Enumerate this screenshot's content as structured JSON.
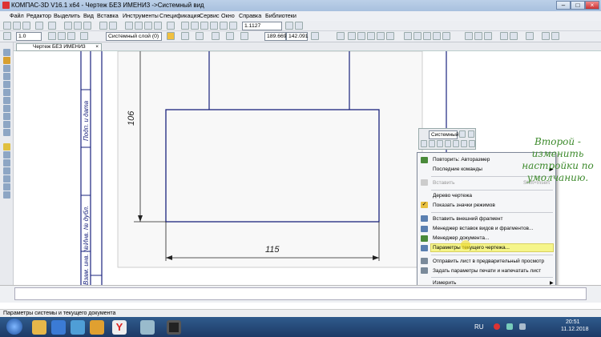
{
  "window": {
    "title": "КОМПАС-3D V16.1 x64 - Чертеж БЕЗ ИМЕНИ3 ->Системный вид",
    "controls": [
      "–",
      "□",
      "×"
    ]
  },
  "menu": [
    "Файл",
    "Редактор",
    "Выделить",
    "Вид",
    "Вставка",
    "Инструменты",
    "Спецификация",
    "Сервис",
    "Окно",
    "Справка",
    "Библиотеки"
  ],
  "toolbar": {
    "zoom_value": "1.1127",
    "layer_value": "Системный слой (0)",
    "linewidth_value": "1.0",
    "coord_x": "189.669",
    "coord_y": "142.091"
  },
  "document_tab": {
    "label": "Чертеж БЕЗ ИМЕНИ3",
    "close": "×"
  },
  "drawing": {
    "dimension_vertical": "106",
    "dimension_horizontal": "115",
    "stamp_texts": [
      "Подп. и дата",
      "Инв. № дубл.",
      "Взам. инв. №"
    ]
  },
  "mini_toolbar": {
    "style_value": "Системный"
  },
  "context_menu": {
    "items": [
      {
        "label": "Повторить: Авторазмер",
        "shortcut": "",
        "disabled": false,
        "icon": "repeat-icon"
      },
      {
        "label": "Последние команды",
        "shortcut": "",
        "disabled": false,
        "submenu": true
      },
      {
        "label": "Вставить",
        "shortcut": "Shift+Insert",
        "disabled": true,
        "icon": "paste-icon"
      },
      {
        "label": "Дерево чертежа",
        "shortcut": "",
        "disabled": false
      },
      {
        "label": "Показать значки режимов",
        "shortcut": "",
        "disabled": false,
        "checked": true
      },
      {
        "label": "Вставить внешний фрагмент",
        "shortcut": "",
        "disabled": false,
        "icon": "fragment-icon"
      },
      {
        "label": "Менеджер вставок видов и фрагментов...",
        "shortcut": "",
        "disabled": false,
        "icon": "manager-icon"
      },
      {
        "label": "Менеджер документа...",
        "shortcut": "",
        "disabled": false,
        "icon": "document-manager-icon"
      },
      {
        "label": "Параметры текущего чертежа...",
        "shortcut": "",
        "disabled": false,
        "highlighted": true,
        "icon": "drawing-params-icon"
      },
      {
        "label": "Отправить лист в предварительный просмотр",
        "shortcut": "",
        "disabled": false,
        "icon": "preview-icon"
      },
      {
        "label": "Задать параметры печати и напечатать лист",
        "shortcut": "",
        "disabled": false,
        "icon": "print-icon"
      },
      {
        "label": "Измерить",
        "shortcut": "",
        "disabled": false,
        "submenu": true
      }
    ]
  },
  "annotation": {
    "text": "Второй - изменить настройки по умолчанию."
  },
  "status": {
    "text": "Параметры системы и текущего документа"
  },
  "taskbar": {
    "lang": "RU",
    "time": "20:51",
    "date": "11.12.2018"
  },
  "colors": {
    "accent": "#3d8a2c",
    "drawing_line": "#1a237e",
    "highlight": "#f5f58a"
  }
}
